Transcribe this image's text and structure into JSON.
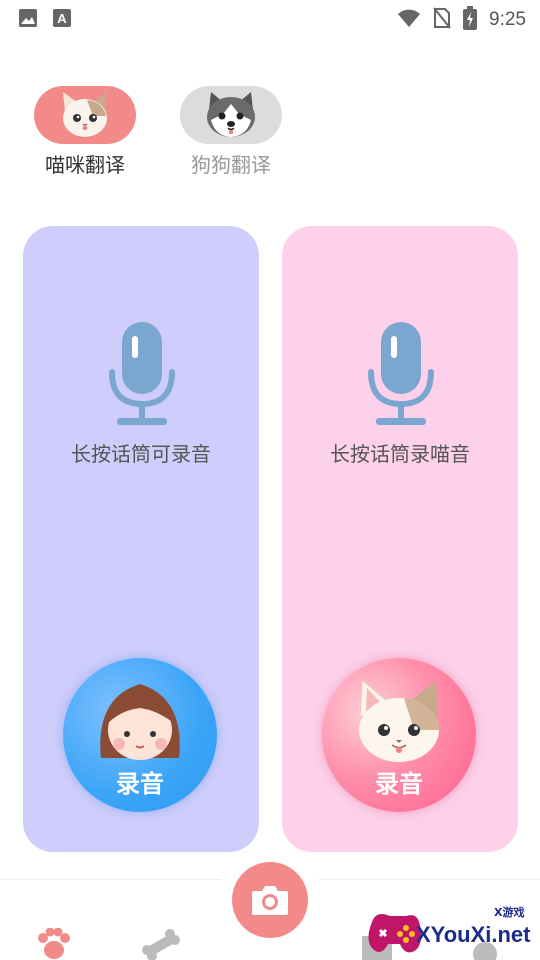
{
  "status_bar": {
    "time": "9:25",
    "icons": [
      "image-icon",
      "a-box-icon",
      "wifi-icon",
      "no-sim-icon",
      "battery-charging-icon"
    ]
  },
  "switch": {
    "cat_label": "喵咪翻译",
    "dog_label": "狗狗翻译",
    "active": "cat",
    "colors": {
      "active_bg": "#f28a8a",
      "inactive_bg": "#dcdcdc"
    }
  },
  "panels": {
    "human": {
      "hint": "长按话筒可录音",
      "button_label": "录音",
      "bg": "#cfcdfb"
    },
    "cat": {
      "hint": "长按话筒录喵音",
      "button_label": "录音",
      "bg": "#fdd1ea"
    }
  },
  "bottom_nav": {
    "items": [
      "paw-icon",
      "bone-icon",
      "camera-icon",
      "gift-icon",
      "profile-icon"
    ],
    "accent": "#f28a8a"
  },
  "watermark": {
    "small": "X游戏",
    "text": "XYouXi.net"
  }
}
